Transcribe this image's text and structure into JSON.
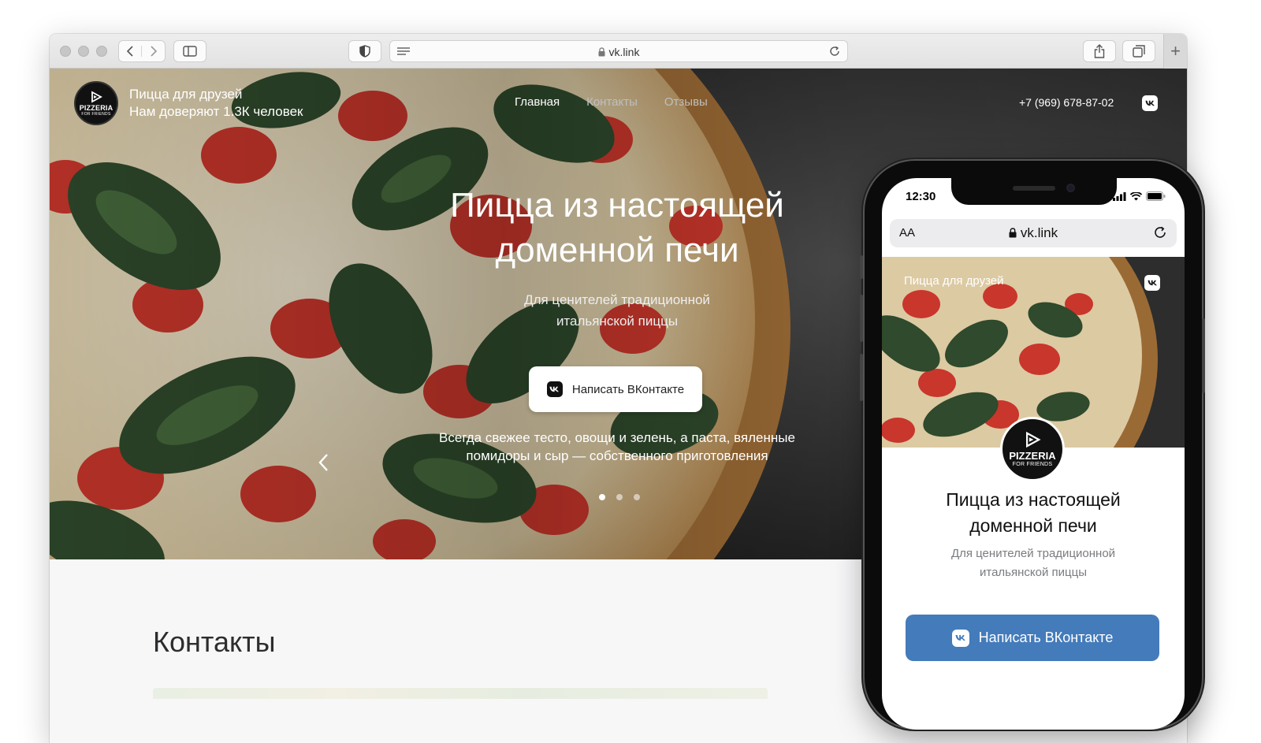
{
  "browser": {
    "url": "vk.link"
  },
  "site": {
    "brand_name": "Пицца для друзей",
    "brand_tagline": "Нам доверяют 1.3К человек",
    "logo_text": "PIZZERIA",
    "logo_subtext": "FOR FRIENDS",
    "nav": [
      {
        "label": "Главная"
      },
      {
        "label": "Контакты"
      },
      {
        "label": "Отзывы"
      }
    ],
    "phone": "+7 (969) 678-87-02",
    "hero": {
      "title_line1": "Пицца из настоящей",
      "title_line2": "доменной печи",
      "subtitle_line1": "Для ценителей традиционной",
      "subtitle_line2": "итальянской пиццы",
      "button_label": "Написать ВКонтакте",
      "note_line1": "Всегда свежее тесто, овощи и зелень, а паста, вяленные",
      "note_line2": "помидоры и сыр — собственного приготовления",
      "active_slide": 1,
      "slide_count": 3
    },
    "contacts_heading": "Контакты"
  },
  "phone_preview": {
    "time": "12:30",
    "aa_label": "AA",
    "url": "vk.link",
    "brand_name": "Пицца для друзей",
    "logo_text": "PIZZERIA",
    "logo_subtext": "FOR FRIENDS",
    "title_line1": "Пицца из настоящей",
    "title_line2": "доменной печи",
    "subtitle_line1": "Для ценителей традиционной",
    "subtitle_line2": "итальянской пиццы",
    "button_label": "Написать ВКонтакте",
    "button_color": "#447bba"
  }
}
